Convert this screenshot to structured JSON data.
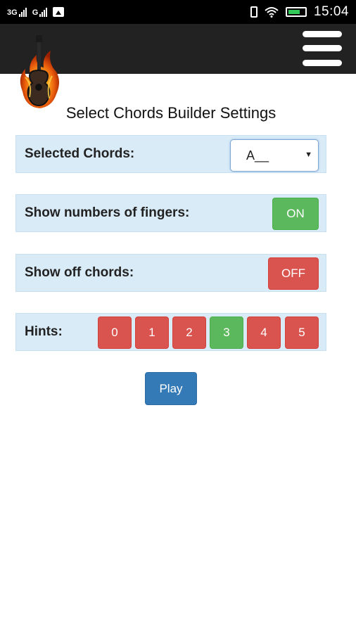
{
  "status_bar": {
    "network_1": "3G",
    "network_2": "G",
    "time": "15:04"
  },
  "app_bar": {
    "logo_icon": "guitar-on-fire-icon",
    "menu_icon": "hamburger-menu-icon"
  },
  "page": {
    "title": "Select Chords Builder Settings"
  },
  "settings": {
    "selected_chords": {
      "label": "Selected Chords:",
      "value": "A__"
    },
    "show_fingers": {
      "label": "Show numbers of fingers:",
      "toggle": "ON"
    },
    "show_off_chords": {
      "label": "Show off chords:",
      "toggle": "OFF"
    },
    "hints": {
      "label": "Hints:",
      "options": [
        "0",
        "1",
        "2",
        "3",
        "4",
        "5"
      ],
      "selected": "3"
    }
  },
  "actions": {
    "play_label": "Play"
  },
  "colors": {
    "on": "#5cb85c",
    "off": "#d9534f",
    "primary": "#337ab7",
    "row_bg": "#d9ebf7"
  }
}
